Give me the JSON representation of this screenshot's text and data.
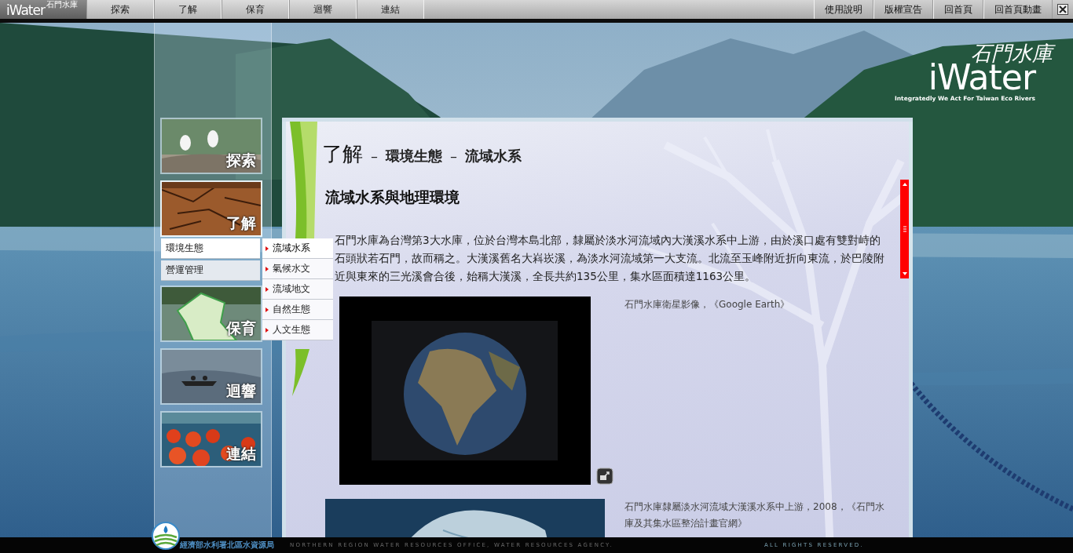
{
  "top_bar": {
    "logo": {
      "name": "iWater",
      "tagline": "石門水庫"
    },
    "nav": [
      {
        "label": "探索"
      },
      {
        "label": "了解"
      },
      {
        "label": "保育"
      },
      {
        "label": "迴響"
      },
      {
        "label": "連結"
      }
    ],
    "links": [
      {
        "label": "使用說明"
      },
      {
        "label": "版權宣告"
      },
      {
        "label": "回首頁"
      },
      {
        "label": "回首頁動畫"
      }
    ]
  },
  "brand": {
    "tagline": "石門水庫",
    "name": "iWater",
    "slogan": "Integratedly We Act For Taiwan Eco Rivers"
  },
  "side_menu": [
    {
      "label": "探索",
      "expanded": false
    },
    {
      "label": "了解",
      "expanded": true,
      "children": [
        {
          "label": "環境生態",
          "selected": true,
          "children": [
            {
              "label": "流域水系",
              "selected": true
            },
            {
              "label": "氣候水文",
              "selected": false
            },
            {
              "label": "流域地文",
              "selected": false
            },
            {
              "label": "自然生態",
              "selected": false
            },
            {
              "label": "人文生態",
              "selected": false
            }
          ]
        },
        {
          "label": "營運管理",
          "selected": false
        }
      ]
    },
    {
      "label": "保育",
      "expanded": false
    },
    {
      "label": "迴響",
      "expanded": false
    },
    {
      "label": "連結",
      "expanded": false
    }
  ],
  "content": {
    "breadcrumb": [
      "了解",
      "環境生態",
      "流域水系"
    ],
    "separator": "–",
    "heading": "流域水系與地理環境",
    "paragraph": "石門水庫為台灣第3大水庫，位於台灣本島北部，隸屬於淡水河流域內大漢溪水系中上游，由於溪口處有雙對峙的石頭狀若石門，故而稱之。大漢溪舊名大嵙崁溪，為淡水河流域第一大支流。北流至玉峰附近折向東流，於巴陵附近與東來的三光溪會合後，始稱大漢溪，全長共約135公里，集水區面積達1163公里。",
    "figures": [
      {
        "kind": "satellite",
        "caption": "石門水庫衛星影像，《Google Earth》"
      },
      {
        "kind": "map",
        "caption": "石門水庫隸屬淡水河流域大漢溪水系中上游，2008，《石門水庫及其集水區整治計畫官網》"
      }
    ]
  },
  "footer": {
    "agency": "經濟部水利署北區水資源局",
    "english": "NORTHERN REGION WATER RESOURCES OFFICE, WATER RESOURCES AGENCY.",
    "rights": "ALL RIGHTS RESERVED."
  }
}
